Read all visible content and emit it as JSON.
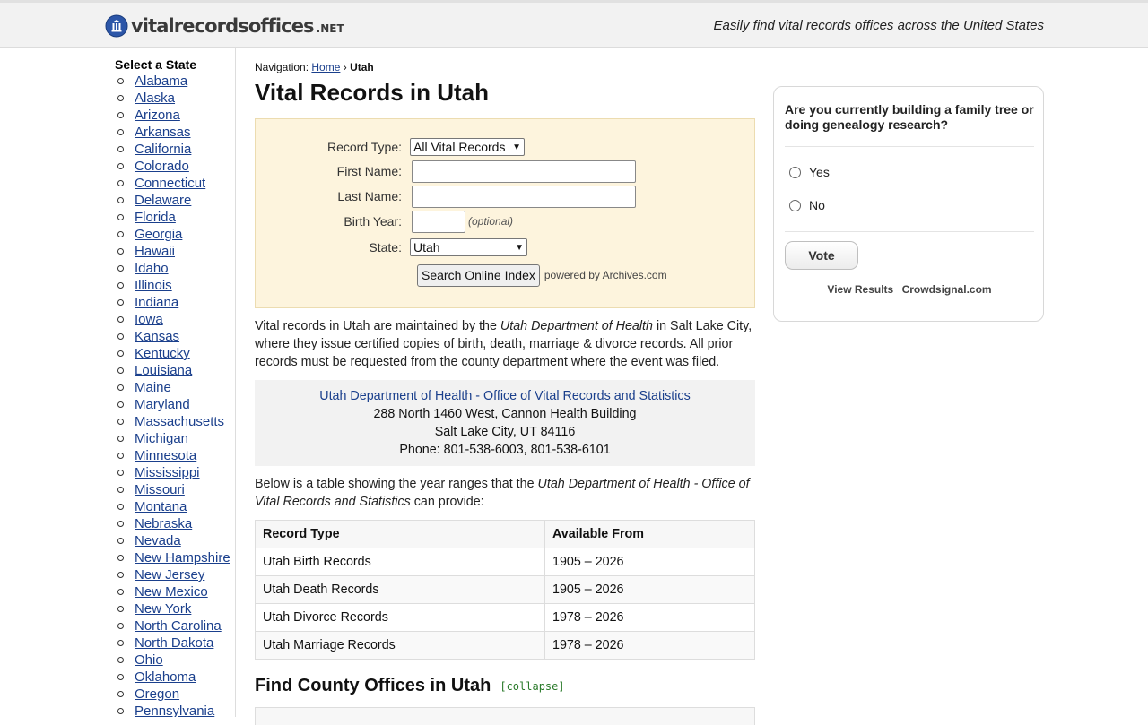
{
  "header": {
    "logo_text": "vitalrecordsoffices",
    "logo_tld": ".NET",
    "tagline": "Easily find vital records offices across the United States"
  },
  "sidebar": {
    "title": "Select a State",
    "states": [
      "Alabama",
      "Alaska",
      "Arizona",
      "Arkansas",
      "California",
      "Colorado",
      "Connecticut",
      "Delaware",
      "Florida",
      "Georgia",
      "Hawaii",
      "Idaho",
      "Illinois",
      "Indiana",
      "Iowa",
      "Kansas",
      "Kentucky",
      "Louisiana",
      "Maine",
      "Maryland",
      "Massachusetts",
      "Michigan",
      "Minnesota",
      "Mississippi",
      "Missouri",
      "Montana",
      "Nebraska",
      "Nevada",
      "New Hampshire",
      "New Jersey",
      "New Mexico",
      "New York",
      "North Carolina",
      "North Dakota",
      "Ohio",
      "Oklahoma",
      "Oregon",
      "Pennsylvania"
    ]
  },
  "breadcrumb": {
    "label": "Navigation:",
    "home": "Home",
    "separator": "›",
    "current": "Utah"
  },
  "page_title": "Vital Records in Utah",
  "search_form": {
    "record_type_label": "Record Type:",
    "record_type_value": "All Vital Records",
    "first_name_label": "First Name:",
    "first_name_value": "",
    "last_name_label": "Last Name:",
    "last_name_value": "",
    "birth_year_label": "Birth Year:",
    "birth_year_value": "",
    "birth_year_hint": "(optional)",
    "state_label": "State:",
    "state_value": "Utah",
    "search_button": "Search Online Index",
    "powered_by": "powered by Archives.com"
  },
  "intro": {
    "part1": "Vital records in Utah are maintained by the ",
    "agency": "Utah Department of Health",
    "part2": " in Salt Lake City, where they issue certified copies of birth, death, marriage & divorce records. All prior records must be requested from the county department where the event was filed."
  },
  "office": {
    "name": "Utah Department of Health - Office of Vital Records and Statistics",
    "address1": "288 North 1460 West, Cannon Health Building",
    "address2": "Salt Lake City, UT 84116",
    "phone": "Phone: 801-538-6003, 801-538-6101"
  },
  "below_text": {
    "part1": "Below is a table showing the year ranges that the ",
    "agency": "Utah Department of Health - Office of Vital Records and Statistics",
    "part2": " can provide:"
  },
  "range_table": {
    "headers": [
      "Record Type",
      "Available From"
    ],
    "rows": [
      [
        "Utah Birth Records",
        "1905 – 2026"
      ],
      [
        "Utah Death Records",
        "1905 – 2026"
      ],
      [
        "Utah Divorce Records",
        "1978 – 2026"
      ],
      [
        "Utah Marriage Records",
        "1978 – 2026"
      ]
    ]
  },
  "county_section": {
    "heading": "Find County Offices in Utah",
    "toggle": "[collapse]"
  },
  "poll": {
    "question": "Are you currently building a family tree or doing genealogy research?",
    "options": [
      "Yes",
      "No"
    ],
    "vote_button": "Vote",
    "view_results": "View Results",
    "provider": "Crowdsignal.com"
  },
  "colors": {
    "link": "#1a3f8c",
    "search_box_bg": "#fdf4dd",
    "toggle": "#2a7a2a",
    "logo_globe": "#2c56a8"
  },
  "icons": {
    "logo": "globe-icon",
    "list_bullet": "circle-bullet",
    "select_arrow": "chevron-down-icon"
  }
}
